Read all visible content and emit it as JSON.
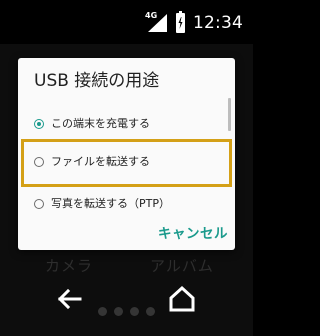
{
  "status_bar": {
    "network": "4G",
    "time": "12:34"
  },
  "dialog": {
    "title": "USB 接続の用途",
    "options": [
      {
        "label": "この端末を充電する",
        "selected": true
      },
      {
        "label": "ファイルを転送する",
        "selected": false
      },
      {
        "label": "写真を転送する（PTP）",
        "selected": false
      }
    ],
    "cancel_label": "キャンセル"
  },
  "launcher": {
    "apps": [
      "カメラ",
      "アルバム"
    ]
  },
  "colors": {
    "accent": "#1a9a8c",
    "highlight": "#d4a017"
  },
  "icons": {
    "signal": "signal-icon",
    "battery": "battery-icon",
    "back": "back-arrow-icon",
    "home": "home-icon"
  }
}
